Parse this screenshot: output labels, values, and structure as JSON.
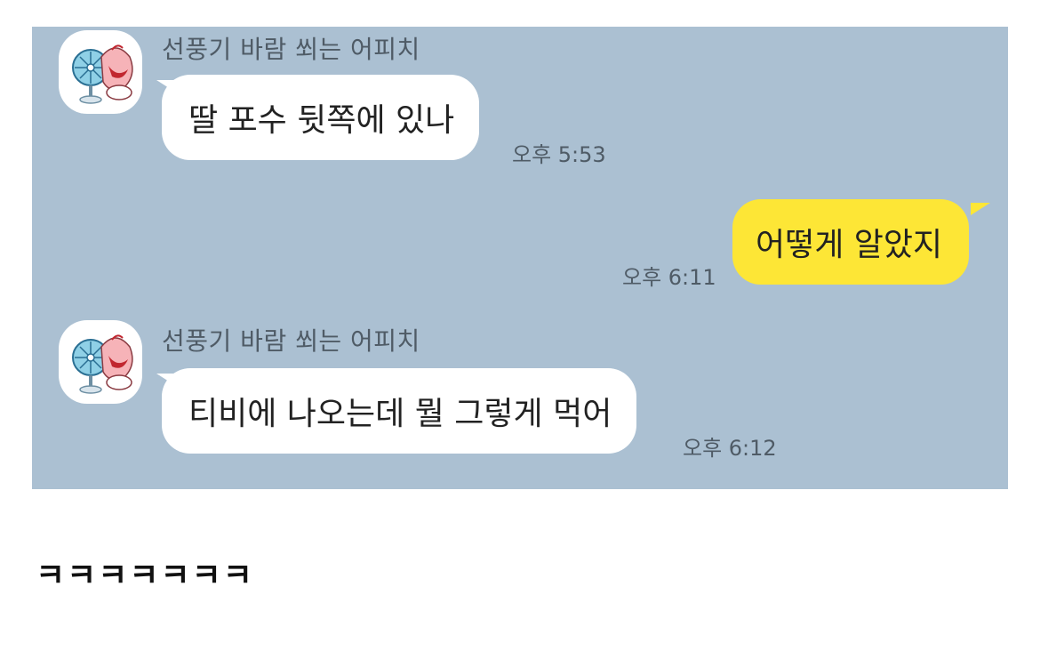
{
  "conversation": {
    "messages": [
      {
        "direction": "incoming",
        "sender": "선풍기 바람 쐬는 어피치",
        "avatar_icon": "apeach-fan-avatar-icon",
        "text": "딸 포수 뒷쪽에 있나",
        "time": "오후 5:53"
      },
      {
        "direction": "outgoing",
        "text": "어떻게 알았지",
        "time": "오후 6:11"
      },
      {
        "direction": "incoming",
        "sender": "선풍기 바람 쐬는 어피치",
        "avatar_icon": "apeach-fan-avatar-icon",
        "text": "티비에 나오는데 뭘 그렇게 먹어",
        "time": "오후 6:12"
      }
    ]
  },
  "caption": "ㅋㅋㅋㅋㅋㅋㅋ",
  "colors": {
    "chat_background": "#abc0d2",
    "incoming_bubble": "#ffffff",
    "outgoing_bubble": "#fde636",
    "meta_text": "#4f5b66"
  }
}
